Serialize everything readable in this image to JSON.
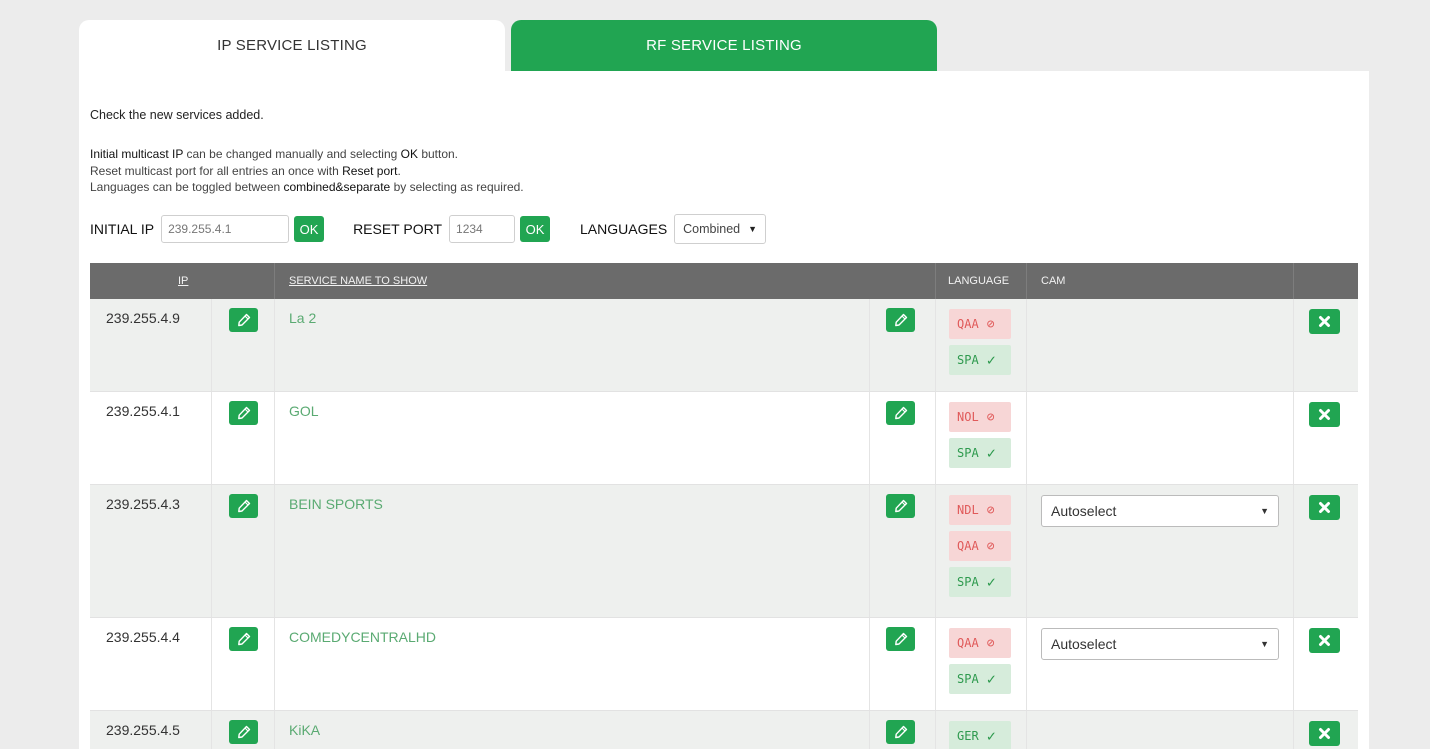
{
  "tabs": [
    {
      "label": "IP SERVICE LISTING"
    },
    {
      "label": "RF SERVICE LISTING"
    }
  ],
  "intro": "Check the new services added.",
  "help": {
    "line1": {
      "b1": "Initial multicast IP",
      "t1": " can be changed manually and selecting ",
      "b2": "OK",
      "t2": " button."
    },
    "line2": {
      "t1": "Reset multicast port for all entries an once with ",
      "b1": "Reset port",
      "t2": "."
    },
    "line3": {
      "t1": "Languages can be toggled between ",
      "b1": "combined&separate",
      "t2": " by selecting as required."
    }
  },
  "controls": {
    "initial_ip_label": "INITIAL IP",
    "initial_ip_value": "239.255.4.1",
    "ok_label": "OK",
    "reset_port_label": "RESET PORT",
    "reset_port_value": "1234",
    "languages_label": "LANGUAGES",
    "languages_value": "Combined"
  },
  "table": {
    "headers": {
      "ip": "IP",
      "service_name": "SERVICE NAME TO SHOW",
      "language": "LANGUAGE",
      "cam": "CAM"
    },
    "rows": [
      {
        "ip": "239.255.4.9",
        "name": "La 2",
        "langs": [
          {
            "code": "QAA",
            "state": "off"
          },
          {
            "code": "SPA",
            "state": "on"
          }
        ],
        "cam": ""
      },
      {
        "ip": "239.255.4.1",
        "name": "GOL",
        "langs": [
          {
            "code": "NOL",
            "state": "off"
          },
          {
            "code": "SPA",
            "state": "on"
          }
        ],
        "cam": ""
      },
      {
        "ip": "239.255.4.3",
        "name": "BEIN SPORTS",
        "langs": [
          {
            "code": "NDL",
            "state": "off"
          },
          {
            "code": "QAA",
            "state": "off"
          },
          {
            "code": "SPA",
            "state": "on"
          }
        ],
        "cam": "Autoselect"
      },
      {
        "ip": "239.255.4.4",
        "name": "COMEDYCENTRALHD",
        "langs": [
          {
            "code": "QAA",
            "state": "off"
          },
          {
            "code": "SPA",
            "state": "on"
          }
        ],
        "cam": "Autoselect"
      },
      {
        "ip": "239.255.4.5",
        "name": "KiKA",
        "langs": [
          {
            "code": "GER",
            "state": "on"
          }
        ],
        "cam": ""
      }
    ]
  },
  "colors": {
    "accent": "#21a552",
    "header_bg": "#6b6b6b",
    "lang_off_bg": "#f7d6d6",
    "lang_on_bg": "#d6ecdb"
  }
}
